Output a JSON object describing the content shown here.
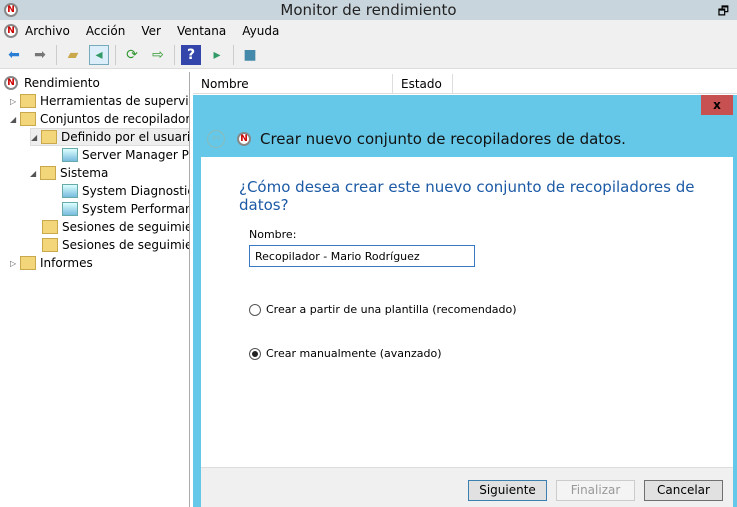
{
  "window": {
    "title": "Monitor de rendimiento",
    "restore": "🗗",
    "close": "✕"
  },
  "menu": [
    "Archivo",
    "Acción",
    "Ver",
    "Ventana",
    "Ayuda"
  ],
  "toolbar_icons": [
    "back-icon",
    "forward-icon",
    "up-folder-icon",
    "show-hide-console-icon",
    "refresh-icon",
    "export-list-icon",
    "help-icon",
    "show-action-pane-icon",
    "new-collector-icon"
  ],
  "tree": {
    "root": "Rendimiento",
    "items": [
      "Herramientas de supervisión",
      "Conjuntos de recopiladores",
      "Definido por el usuario",
      "Server Manager Performance",
      "Sistema",
      "System Diagnostics",
      "System Performance",
      "Sesiones de seguimiento de eventos",
      "Sesiones de seguimiento de eventos de inicio",
      "Informes"
    ]
  },
  "columns": [
    "Nombre",
    "Estado"
  ],
  "dialog": {
    "close": "x",
    "title": "Crear nuevo conjunto de recopiladores de datos.",
    "question": "¿Cómo desea crear este nuevo conjunto de recopiladores de datos?",
    "name_label": "Nombre:",
    "name_value": "Recopilador - Mario Rodríguez",
    "option_template": "Crear a partir de una plantilla (recomendado)",
    "option_manual": "Crear manualmente (avanzado)",
    "selected": "manual",
    "next": "Siguiente",
    "finish": "Finalizar",
    "cancel": "Cancelar"
  },
  "colors": {
    "dialog_frame": "#66c8e8",
    "question": "#1c5aa6",
    "close": "#c75050"
  }
}
